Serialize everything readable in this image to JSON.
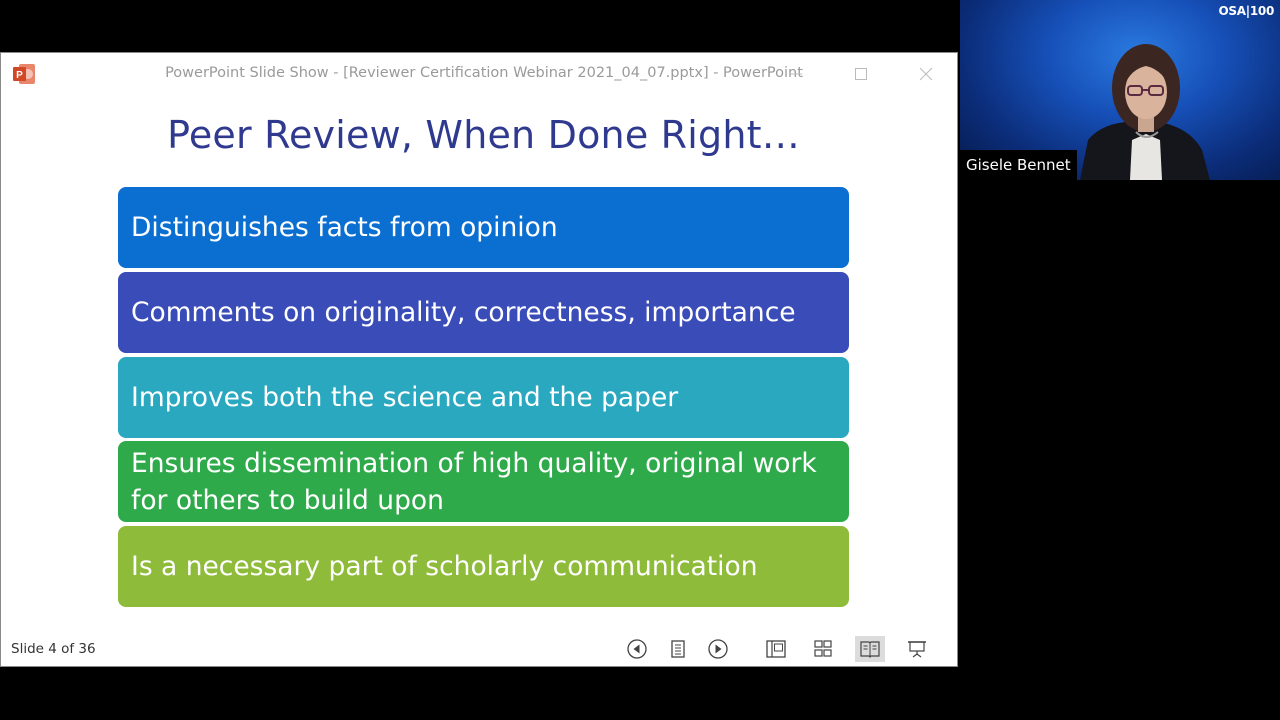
{
  "window": {
    "title": "PowerPoint Slide Show - [Reviewer Certification Webinar 2021_04_07.pptx] - PowerPoint"
  },
  "slide": {
    "title": "Peer Review, When Done Right…",
    "bullets": [
      {
        "text": "Distinguishes facts from opinion",
        "color": "#0a6fd0"
      },
      {
        "text": "Comments on originality, correctness, importance",
        "color": "#3a4cb8"
      },
      {
        "text": "Improves both the science and the paper",
        "color": "#2aa8c0"
      },
      {
        "text": "Ensures dissemination of high quality, original work for others to build upon",
        "color": "#2faa4a"
      },
      {
        "text": "Is a necessary part of scholarly communication",
        "color": "#8ebb3a"
      }
    ]
  },
  "statusbar": {
    "slide_counter": "Slide 4 of 36"
  },
  "icons": {
    "prev": "previous-slide-icon",
    "slide_menu": "slide-menu-icon",
    "next": "next-slide-icon",
    "normal_view": "normal-view-icon",
    "sorter_view": "slide-sorter-icon",
    "reading_view": "reading-view-icon",
    "slideshow": "slideshow-icon"
  },
  "video": {
    "participant": "Gisele Bennet",
    "logo": "OSA|100"
  },
  "colors": {
    "title": "#2f3a8f",
    "ppt_brand": "#d24726"
  }
}
